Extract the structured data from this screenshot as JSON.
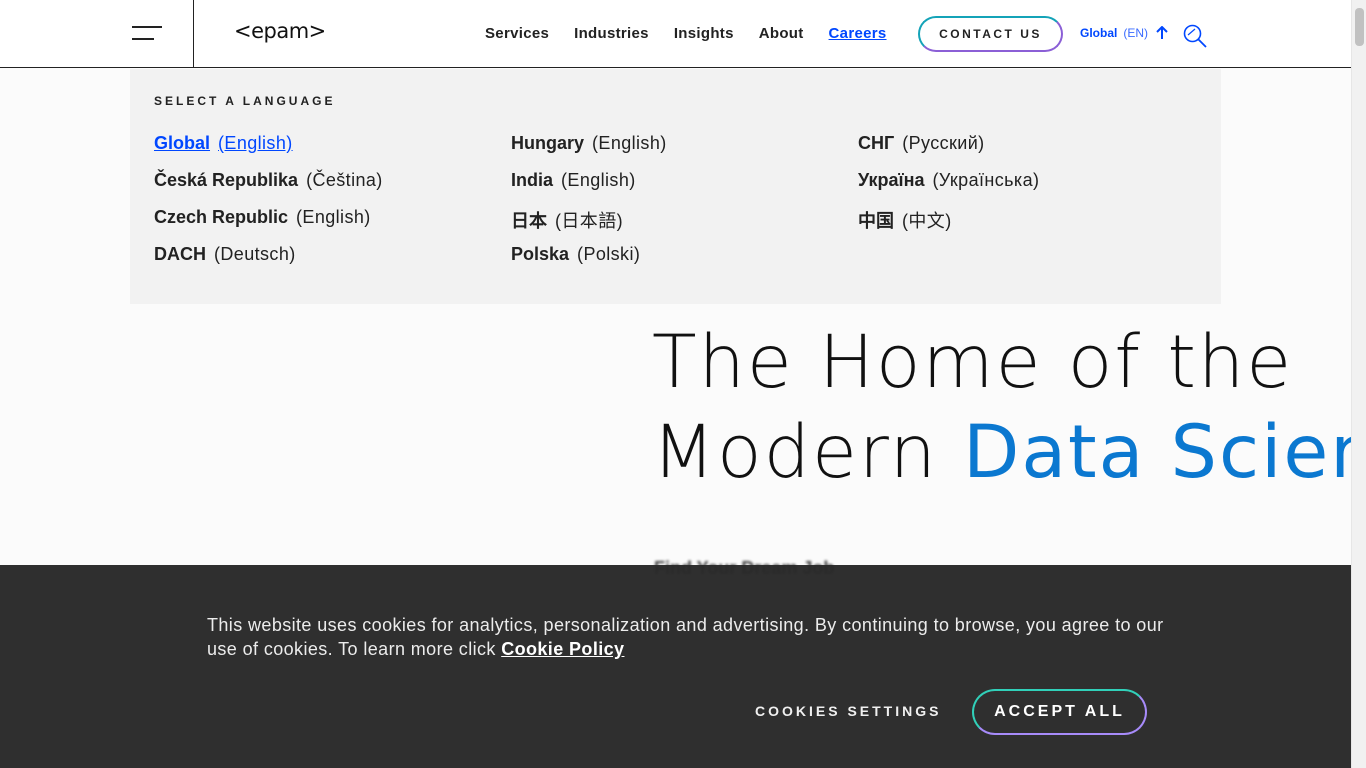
{
  "header": {
    "logo": "<epam>",
    "nav": [
      "Services",
      "Industries",
      "Insights",
      "About",
      "Careers"
    ],
    "active_nav": "Careers",
    "contact_label": "CONTACT US",
    "lang_region": "Global",
    "lang_code": "(EN)"
  },
  "language_panel": {
    "title": "SELECT A LANGUAGE",
    "columns": [
      [
        {
          "country": "Global",
          "lang": "(English)",
          "selected": true
        },
        {
          "country": "Česká Republika",
          "lang": "(Čeština)"
        },
        {
          "country": "Czech Republic",
          "lang": "(English)"
        },
        {
          "country": "DACH",
          "lang": "(Deutsch)"
        }
      ],
      [
        {
          "country": "Hungary",
          "lang": "(English)"
        },
        {
          "country": "India",
          "lang": "(English)"
        },
        {
          "country": "日本",
          "lang": "(日本語)"
        },
        {
          "country": "Polska",
          "lang": "(Polski)"
        }
      ],
      [
        {
          "country": "СНГ",
          "lang": "(Русский)"
        },
        {
          "country": "Україна",
          "lang": "(Українська)"
        },
        {
          "country": "中国",
          "lang": "(中文)"
        }
      ]
    ]
  },
  "hero": {
    "line1": "The Home of the",
    "line2_plain": "Modern ",
    "line2_accent": "Data Scien",
    "subtitle": "Find Your Dream Job"
  },
  "cookie": {
    "text": "This website uses cookies for analytics, personalization and advertising. By continuing to browse, you agree to our use of cookies. To learn more click ",
    "link": "Cookie Policy",
    "settings_label": "COOKIES SETTINGS",
    "accept_label": "ACCEPT ALL"
  },
  "colors": {
    "accent": "#0047ff",
    "hero_accent": "#0b78d0",
    "banner_bg": "#282828"
  }
}
